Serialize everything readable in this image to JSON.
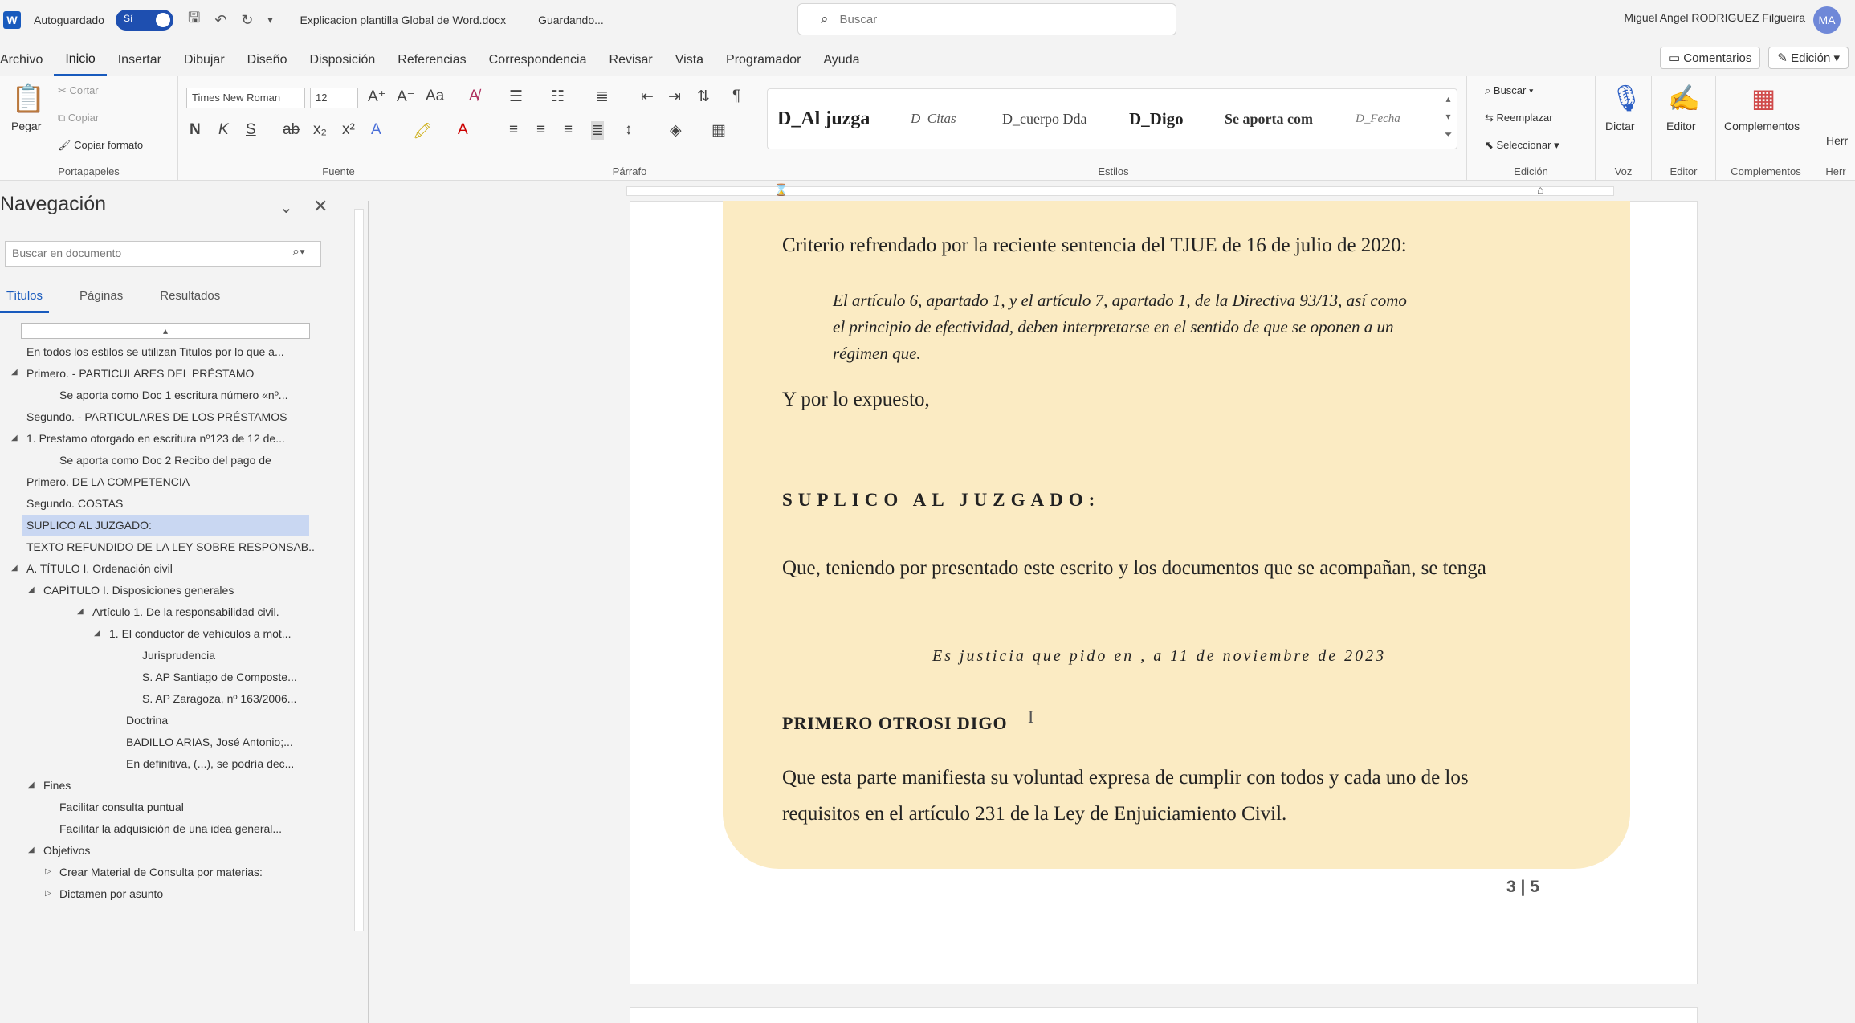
{
  "titlebar": {
    "logo": "W",
    "autosave_label": "Autoguardado",
    "toggle_label": "Sí",
    "doc_name": "Explicacion plantilla Global de Word.docx",
    "status": "Guardando...",
    "search_placeholder": "Buscar",
    "user": "Miguel Angel RODRIGUEZ Filgueira",
    "avatar": "MA"
  },
  "menu": {
    "tabs": [
      "Archivo",
      "Inicio",
      "Insertar",
      "Dibujar",
      "Diseño",
      "Disposición",
      "Referencias",
      "Correspondencia",
      "Revisar",
      "Vista",
      "Programador",
      "Ayuda"
    ],
    "active": "Inicio",
    "comments": "Comentarios",
    "editing": "Edición"
  },
  "ribbon": {
    "clipboard": {
      "paste": "Pegar",
      "cut": "Cortar",
      "copy": "Copiar",
      "format_painter": "Copiar formato",
      "label": "Portapapeles"
    },
    "font": {
      "name": "Times New Roman",
      "size": "12",
      "label": "Fuente"
    },
    "paragraph": {
      "label": "Párrafo"
    },
    "styles": {
      "items": [
        "D_Al juzga",
        "D_Citas",
        "D_cuerpo Dda",
        "D_Digo",
        "Se aporta com",
        "D_Fecha"
      ],
      "label": "Estilos"
    },
    "editing": {
      "find": "Buscar",
      "replace": "Reemplazar",
      "select": "Seleccionar",
      "label": "Edición"
    },
    "voice": {
      "dictate": "Dictar",
      "label": "Voz"
    },
    "editor": {
      "editor": "Editor",
      "label": "Editor"
    },
    "addins": {
      "addins": "Complementos",
      "label": "Complementos"
    },
    "tools": {
      "label": "Herr",
      "tool": "Herr"
    }
  },
  "nav": {
    "title": "Navegación",
    "search_placeholder": "Buscar en documento",
    "tabs": [
      "Títulos",
      "Páginas",
      "Resultados"
    ],
    "items": [
      "En todos los estilos se utilizan Titulos por lo que a...",
      "Primero. - PARTICULARES DEL PRÉSTAMO",
      "Se aporta como Doc 1 escritura número «nº...",
      "Segundo. - PARTICULARES DE LOS PRÉSTAMOS",
      "1. Prestamo otorgado en escritura nº123 de 12 de...",
      "Se aporta como Doc 2 Recibo del pago de",
      "Primero. DE LA COMPETENCIA",
      "Segundo. COSTAS",
      "SUPLICO AL JUZGADO:",
      "TEXTO REFUNDIDO DE LA LEY SOBRE RESPONSAB...",
      "A. TÍTULO I. Ordenación civil",
      "CAPÍTULO I. Disposiciones generales",
      "Artículo 1. De la responsabilidad civil.",
      "1. El conductor de vehículos a mot...",
      "Jurisprudencia",
      "S. AP Santiago de Composte...",
      "S. AP Zaragoza, nº 163/2006...",
      "Doctrina",
      "BADILLO ARIAS, José Antonio;...",
      "En definitiva, (...), se podría dec...",
      "Fines",
      "Facilitar consulta puntual",
      "Facilitar la adquisición de una idea general...",
      "Objetivos",
      "Crear Material de Consulta por materias:",
      "Dictamen por asunto"
    ]
  },
  "doc": {
    "p1": "Criterio refrendado por la reciente sentencia del TJUE de 16 de julio de 2020:",
    "quote": [
      "El artículo 6, apartado 1, y el artículo 7, apartado 1, de la Directiva 93/13, así como",
      "el principio de efectividad, deben interpretarse en el sentido de que se oponen a un",
      "régimen que."
    ],
    "p2": "Y por lo expuesto,",
    "heading": "SUPLICO AL JUZGADO:",
    "p3": "Que, teniendo por presentado este escrito y los documentos que se acompañan, se tenga",
    "date": "Es justicia que pido en , a 11 de noviembre de 2023",
    "heading2": "PRIMERO OTROSI DIGO",
    "p4a": "Que esta parte manifiesta su voluntad expresa de cumplir con todos y cada uno de los",
    "p4b": "requisitos en el artículo 231 de la Ley de Enjuiciamiento Civil.",
    "page_num": "3 | 5"
  }
}
